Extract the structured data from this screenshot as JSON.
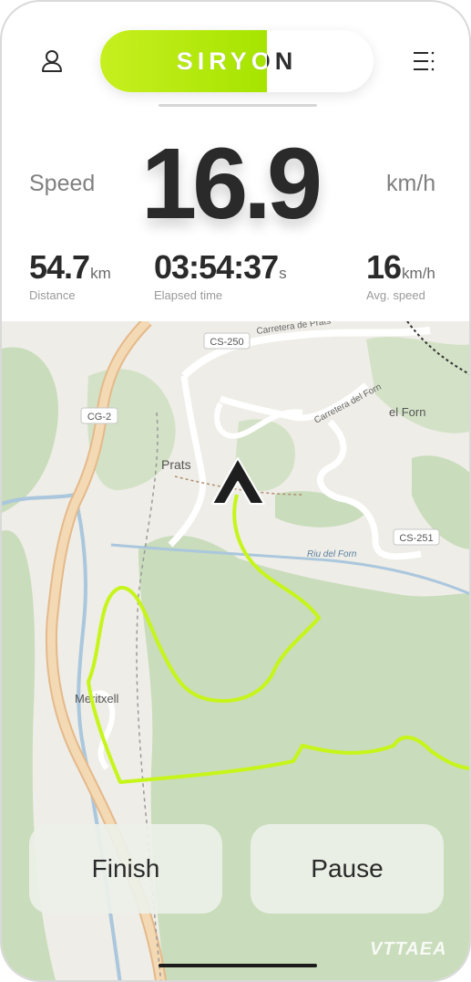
{
  "header": {
    "brand": "SIRYON",
    "brand_progress": 0.61,
    "profile_icon": "user-icon",
    "menu_icon": "menu-icon"
  },
  "speed": {
    "label": "Speed",
    "value": "16.9",
    "unit": "km/h"
  },
  "stats": {
    "distance": {
      "value": "54.7",
      "unit": "km",
      "label": "Distance"
    },
    "elapsed": {
      "value": "03:54:37",
      "unit": "s",
      "label": "Elapsed time"
    },
    "avg_speed": {
      "value": "16",
      "unit": "km/h",
      "label": "Avg. speed"
    }
  },
  "map": {
    "labels": {
      "cs250": "CS-250",
      "cg2": "CG-2",
      "cs251": "CS-251",
      "prats": "Prats",
      "el_forn": "el Forn",
      "meritxell": "Meritxell",
      "carretera_prats": "Carretera de Prats",
      "carretera_forn": "Carretera del Forn",
      "riu_forn": "Riu del Forn"
    },
    "route_color": "#c6f51a",
    "position_icon": "navigation-arrow-icon"
  },
  "actions": {
    "finish": "Finish",
    "pause": "Pause"
  },
  "watermark": "VTTAEA",
  "colors": {
    "accent": "#b5ea10",
    "text": "#2a2a2a",
    "muted": "#808080"
  }
}
